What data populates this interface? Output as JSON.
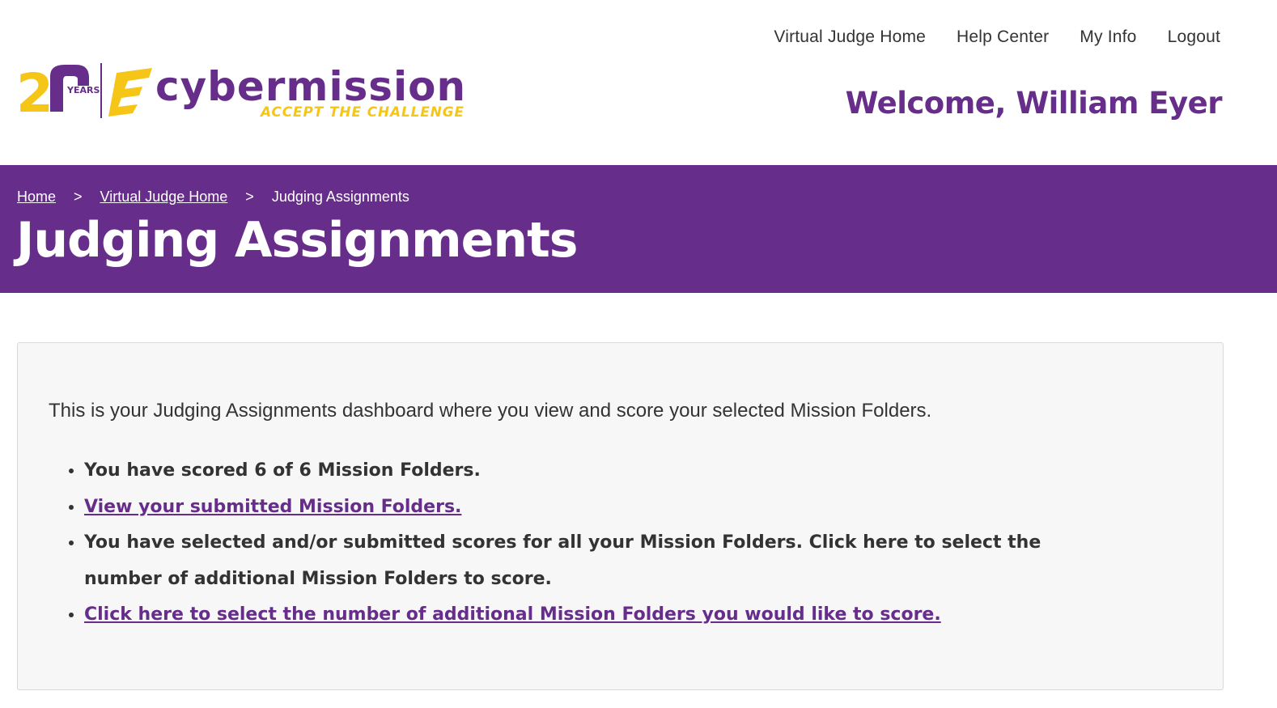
{
  "colors": {
    "brand_purple": "#662d8a",
    "brand_yellow": "#f5c518",
    "text_dark": "#333333",
    "panel_bg": "#f7f7f7"
  },
  "logo": {
    "years_number": "2",
    "years_label": "YEARS",
    "brand_name": "cybermission",
    "tagline": "ACCEPT THE CHALLENGE"
  },
  "nav": {
    "items": [
      {
        "label": "Virtual Judge Home"
      },
      {
        "label": "Help Center"
      },
      {
        "label": "My Info"
      },
      {
        "label": "Logout"
      }
    ]
  },
  "welcome": "Welcome, William Eyer",
  "breadcrumb": {
    "items": [
      {
        "label": "Home"
      },
      {
        "label": "Virtual Judge Home"
      },
      {
        "label": "Judging Assignments"
      }
    ],
    "separator": ">"
  },
  "page_title": "Judging Assignments",
  "panel": {
    "intro": "This is your Judging Assignments dashboard where you view and score your selected Mission Folders.",
    "items": [
      {
        "text": "You have scored 6 of 6 Mission Folders."
      },
      {
        "link": "View your submitted Mission Folders."
      },
      {
        "text": "You have selected and/or submitted scores for all your Mission Folders. Click here to select the number of additional Mission Folders to score."
      },
      {
        "link": "Click here to select the number of additional Mission Folders you would like to score."
      }
    ]
  }
}
